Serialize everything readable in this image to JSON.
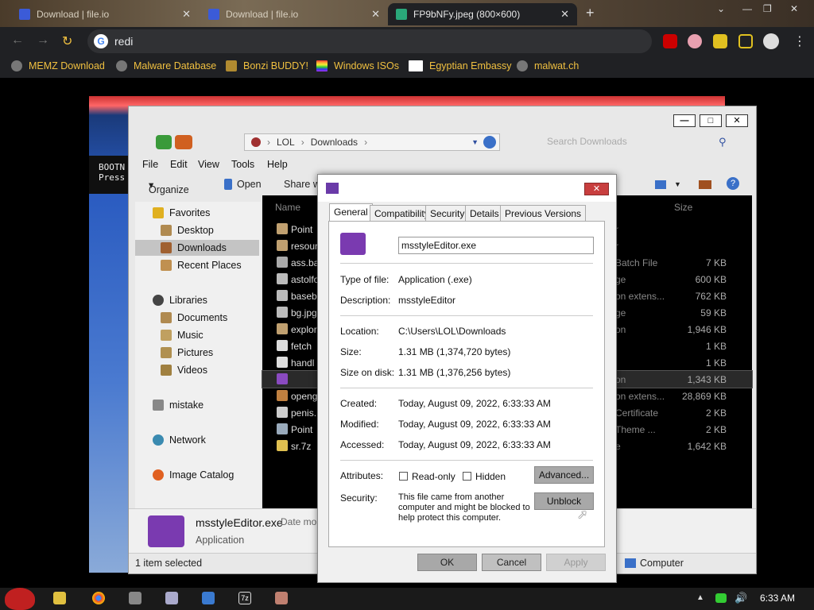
{
  "browser": {
    "tabs": [
      {
        "title": "Download | file.io",
        "active": false
      },
      {
        "title": "Download | file.io",
        "active": false
      },
      {
        "title": "FP9bNFy.jpeg (800×600)",
        "active": true
      }
    ],
    "omnibox_text": "redi",
    "bookmarks": [
      "MEMZ Download",
      "Malware Database",
      "Bonzi BUDDY!",
      "Windows ISOs",
      "Egyptian Embassy",
      "malwat.ch"
    ]
  },
  "background_image": {
    "panel_text": "BOOTN\nPress"
  },
  "explorer": {
    "breadcrumb": [
      "LOL",
      "Downloads"
    ],
    "search_placeholder": "Search Downloads",
    "menu": [
      "File",
      "Edit",
      "View",
      "Tools",
      "Help"
    ],
    "commands": {
      "organize": "Organize",
      "open": "Open",
      "share": "Share w"
    },
    "nav": {
      "favorites": "Favorites",
      "desktop": "Desktop",
      "downloads": "Downloads",
      "recent": "Recent Places",
      "libraries": "Libraries",
      "documents": "Documents",
      "music": "Music",
      "pictures": "Pictures",
      "videos": "Videos",
      "mistake": "mistake",
      "network": "Network",
      "image_catalog": "Image Catalog"
    },
    "columns": {
      "name": "Name",
      "size": "Size"
    },
    "files": [
      {
        "name": "Point",
        "type": "r",
        "size": ""
      },
      {
        "name": "resour",
        "type": "r",
        "size": ""
      },
      {
        "name": "ass.ba",
        "type": "Batch File",
        "size": "7 KB"
      },
      {
        "name": "astolfo",
        "type": "ge",
        "size": "600 KB"
      },
      {
        "name": "baseb",
        "type": "on extens...",
        "size": "762 KB"
      },
      {
        "name": "bg.jpg",
        "type": "ge",
        "size": "59 KB"
      },
      {
        "name": "explor",
        "type": "on",
        "size": "1,946 KB"
      },
      {
        "name": "fetch",
        "type": "",
        "size": "1 KB"
      },
      {
        "name": "handl",
        "type": "",
        "size": "1 KB"
      },
      {
        "name": "",
        "type": "on",
        "size": "1,343 KB"
      },
      {
        "name": "openg",
        "type": "on extens...",
        "size": "28,869 KB"
      },
      {
        "name": "penis.",
        "type": "Certificate",
        "size": "2 KB"
      },
      {
        "name": "Point",
        "type": "Theme ...",
        "size": "2 KB"
      },
      {
        "name": "sr.7z",
        "type": "e",
        "size": "1,642 KB"
      }
    ],
    "details": {
      "name": "msstyleEditor.exe",
      "type": "Application",
      "date_label": "Date mo"
    },
    "status": {
      "selected": "1 item selected",
      "computer": "Computer"
    }
  },
  "dialog": {
    "tabs": [
      "General",
      "Compatibility",
      "Security",
      "Details",
      "Previous Versions"
    ],
    "filename": "msstyleEditor.exe",
    "labels": {
      "type": "Type of file:",
      "description": "Description:",
      "location": "Location:",
      "size": "Size:",
      "size_on_disk": "Size on disk:",
      "created": "Created:",
      "modified": "Modified:",
      "accessed": "Accessed:",
      "attributes": "Attributes:",
      "security": "Security:"
    },
    "values": {
      "type": "Application (.exe)",
      "description": "msstyleEditor",
      "location": "C:\\Users\\LOL\\Downloads",
      "size": "1.31 MB (1,374,720 bytes)",
      "size_on_disk": "1.31 MB (1,376,256 bytes)",
      "created": "Today, August 09, 2022, 6:33:33 AM",
      "modified": "Today, August 09, 2022, 6:33:33 AM",
      "accessed": "Today, August 09, 2022, 6:33:33 AM",
      "security_line1": "This file came from another",
      "security_line2": "computer and might be blocked to",
      "security_line3": "help protect this computer."
    },
    "attributes": {
      "readonly": "Read-only",
      "hidden": "Hidden"
    },
    "buttons": {
      "advanced": "Advanced...",
      "unblock": "Unblock",
      "ok": "OK",
      "cancel": "Cancel",
      "apply": "Apply"
    }
  },
  "taskbar": {
    "clock": "6:33 AM"
  }
}
